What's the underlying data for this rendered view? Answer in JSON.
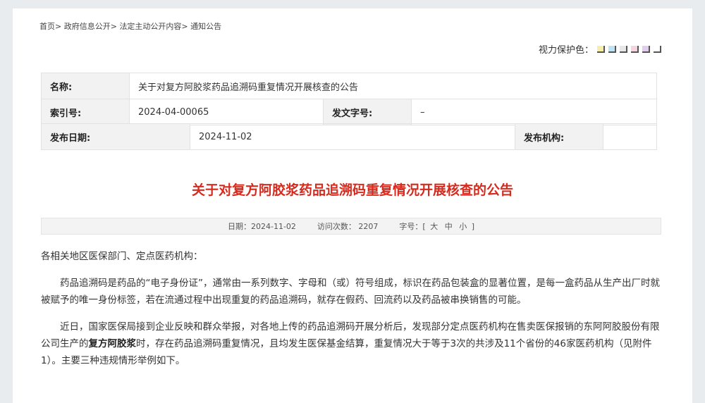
{
  "breadcrumb": {
    "home": "首页>",
    "gov_info": "政府信息公开>",
    "statutory": "法定主动公开内容>",
    "notices": "通知公告"
  },
  "vision": {
    "label": "视力保护色：",
    "swatches": [
      "#f7eea8",
      "#bfe3f4",
      "#e7e7e7",
      "#f6d3e1",
      "#e2cdef",
      "#ffffff"
    ]
  },
  "meta": {
    "name_label": "名称:",
    "name_value": "关于对复方阿胶浆药品追溯码重复情况开展核查的公告",
    "index_label": "索引号:",
    "index_value": "2024-04-00065",
    "doc_no_label": "发文字号:",
    "doc_no_value": "–",
    "date_label": "发布日期:",
    "date_value": "2024-11-02",
    "org_label": "发布机构:",
    "org_value": ""
  },
  "article": {
    "title": "关于对复方阿胶浆药品追溯码重复情况开展核查的公告",
    "date_text": "日期：2024-11-02",
    "visits_text": "访问次数： 2207",
    "font_label": "字号：[",
    "font_large": "大",
    "font_medium": "中",
    "font_small": "小",
    "font_close": "]",
    "salutation": "各相关地区医保部门、定点医药机构：",
    "para1": "药品追溯码是药品的“电子身份证”，通常由一系列数字、字母和（或）符号组成，标识在药品包装盒的显著位置，是每一盒药品从生产出厂时就被赋予的唯一身份标签，若在流通过程中出现重复的药品追溯码，就存在假药、回流药以及药品被串换销售的可能。",
    "para2_a": "近日，国家医保局接到企业反映和群众举报，对各地上传的药品追溯码开展分析后，发现部分定点医药机构在售卖医保报销的东阿阿胶股份有限公司生产的",
    "para2_bold": "复方阿胶浆",
    "para2_b": "时，存在药品追溯码重复情况，且均发生医保基金结算，重复情况大于等于3次的共涉及11个省份的46家医药机构（见附件1）。主要三种违规情形举例如下。"
  }
}
